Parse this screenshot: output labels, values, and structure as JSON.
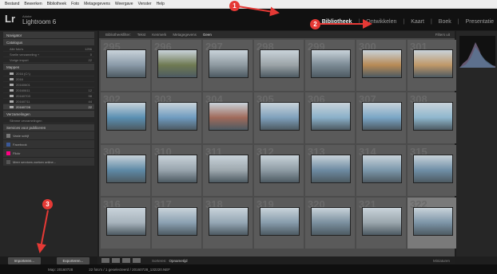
{
  "menubar": [
    "Bestand",
    "Bewerken",
    "Bibliotheek",
    "Foto",
    "Metagegevens",
    "Weergave",
    "Venster",
    "Help"
  ],
  "app": {
    "name_small": "Adobe",
    "name": "Lightroom 6"
  },
  "modules": [
    {
      "label": "Bibliotheek",
      "active": true
    },
    {
      "label": "Ontwikkelen",
      "active": false
    },
    {
      "label": "Kaart",
      "active": false
    },
    {
      "label": "Boek",
      "active": false
    },
    {
      "label": "Presentatie",
      "active": false
    }
  ],
  "left_panel": {
    "navigator": "Navigator",
    "catalog": {
      "title": "Catalogus",
      "items": [
        {
          "label": "Alle foto's",
          "count": "1256"
        },
        {
          "label": "Snelle verzameling +",
          "count": "0"
        },
        {
          "label": "Vorige import",
          "count": "22"
        }
      ]
    },
    "folders": {
      "title": "Mappen",
      "items": [
        {
          "label": "2016 (C:\\)",
          "count": ""
        },
        {
          "label": "2016",
          "count": ""
        },
        {
          "label": "20160601",
          "count": ""
        },
        {
          "label": "20160611",
          "count": "12"
        },
        {
          "label": "20160703",
          "count": "98"
        },
        {
          "label": "20160711",
          "count": "44"
        },
        {
          "label": "20160728",
          "count": "22"
        }
      ]
    },
    "collections": {
      "title": "Verzamelingen",
      "item": "Slimme verzamelingen"
    },
    "publish": {
      "title": "Services voor publiceren",
      "items": [
        "Vaste schijf",
        "Facebook",
        "Flickr",
        "Meer services zoeken online..."
      ]
    },
    "import_button": "Importeren...",
    "export_button": "Exporteren..."
  },
  "filterbar": {
    "label": "Bibliotheekfilter:",
    "options": [
      "Tekst",
      "Kenmerk",
      "Metagegevens",
      "Geen"
    ],
    "preset": "Filters uit"
  },
  "grid": {
    "cells": [
      {
        "num": "295",
        "color": "#8a9aa8"
      },
      {
        "num": "296",
        "color": "#6f7a52"
      },
      {
        "num": "297",
        "color": "#8e99a0"
      },
      {
        "num": "298",
        "color": "#9ba3a7"
      },
      {
        "num": "299",
        "color": "#7b8a94"
      },
      {
        "num": "300",
        "color": "#b78a55"
      },
      {
        "num": "301",
        "color": "#c09868"
      },
      {
        "num": "302",
        "color": "#5a8fb2"
      },
      {
        "num": "303",
        "color": "#6f9bc0"
      },
      {
        "num": "304",
        "color": "#a06a5a"
      },
      {
        "num": "305",
        "color": "#7fa1bc"
      },
      {
        "num": "306",
        "color": "#8ab0c9"
      },
      {
        "num": "307",
        "color": "#7aa6c6"
      },
      {
        "num": "308",
        "color": "#8fb7ce"
      },
      {
        "num": "309",
        "color": "#5e89a6"
      },
      {
        "num": "310",
        "color": "#98a4ad"
      },
      {
        "num": "311",
        "color": "#9ea8ae"
      },
      {
        "num": "312",
        "color": "#8e9ba4"
      },
      {
        "num": "313",
        "color": "#6d8aa1"
      },
      {
        "num": "314",
        "color": "#7b97ab"
      },
      {
        "num": "315",
        "color": "#6f8ea6"
      },
      {
        "num": "316",
        "color": "#a7b3bc"
      },
      {
        "num": "317",
        "color": "#8aa0b1"
      },
      {
        "num": "318",
        "color": "#94a6b4"
      },
      {
        "num": "319",
        "color": "#869bab"
      },
      {
        "num": "320",
        "color": "#7a8f9e"
      },
      {
        "num": "321",
        "color": "#9aa6ad"
      },
      {
        "num": "322",
        "color": "#7c94a7"
      }
    ]
  },
  "toolbar": {
    "sort_label": "Sorteren:",
    "sort_value": "Opnametijd",
    "thumb_label": "Miniaturen"
  },
  "status": {
    "text": "Map: 20160728",
    "count": "22 foto's / 1 geselecteerd / 20160728_132220.NEF"
  },
  "annotations": [
    "1",
    "2",
    "3"
  ],
  "colors": {
    "accent": "#e53935",
    "active_module": "#f2f2f2"
  }
}
